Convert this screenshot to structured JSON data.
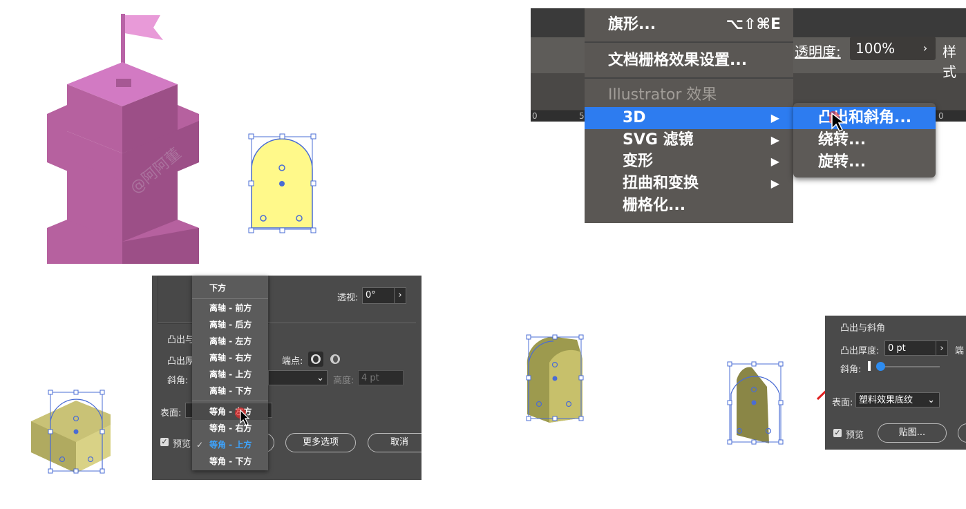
{
  "top_right_menu": {
    "items": [
      {
        "label": "旗形...",
        "shortcut": "⌥⇧⌘E"
      },
      {
        "label": "文档栅格效果设置..."
      },
      {
        "label": "Illustrator 效果"
      },
      {
        "label": "3D"
      },
      {
        "label": "SVG 滤镜"
      },
      {
        "label": "变形"
      },
      {
        "label": "扭曲和变换"
      },
      {
        "label": "栅格化..."
      }
    ],
    "submenu": [
      "凸出和斜角...",
      "绕转...",
      "旋转..."
    ],
    "toolbar": {
      "opacity_label": "透明度:",
      "opacity_value": "100%",
      "style_label": "样式"
    },
    "ruler": [
      "0",
      "5",
      "0"
    ]
  },
  "bottom_left_dialog": {
    "perspective_label": "透视:",
    "perspective_value": "0°",
    "section": "凸出与",
    "extrude_label": "凸出厚",
    "cap_label": "端点:",
    "bevel_label": "斜角:",
    "height_label": "高度:",
    "height_value": "4 pt",
    "surface_label": "表面:",
    "preview_label": "预览",
    "more_options": "更多选项",
    "cancel": "取消",
    "dropdown": {
      "top_item": "下方",
      "items": [
        "离轴 - 前方",
        "离轴 - 后方",
        "离轴 - 左方",
        "离轴 - 右方",
        "离轴 - 上方",
        "离轴 - 下方",
        "等角 - 左方",
        "等角 - 右方",
        "等角 - 上方",
        "等角 - 下方"
      ],
      "checked": "等角 - 上方"
    }
  },
  "bottom_right_dialog": {
    "section": "凸出与斜角",
    "depth_label": "凸出厚度:",
    "depth_value": "0 pt",
    "cap_label": "端",
    "bevel_label": "斜角:",
    "surface_label": "表面:",
    "surface_value": "塑料效果底纹",
    "preview_label": "预览",
    "map_button": "贴图..."
  },
  "watermark": "@阿阿董"
}
